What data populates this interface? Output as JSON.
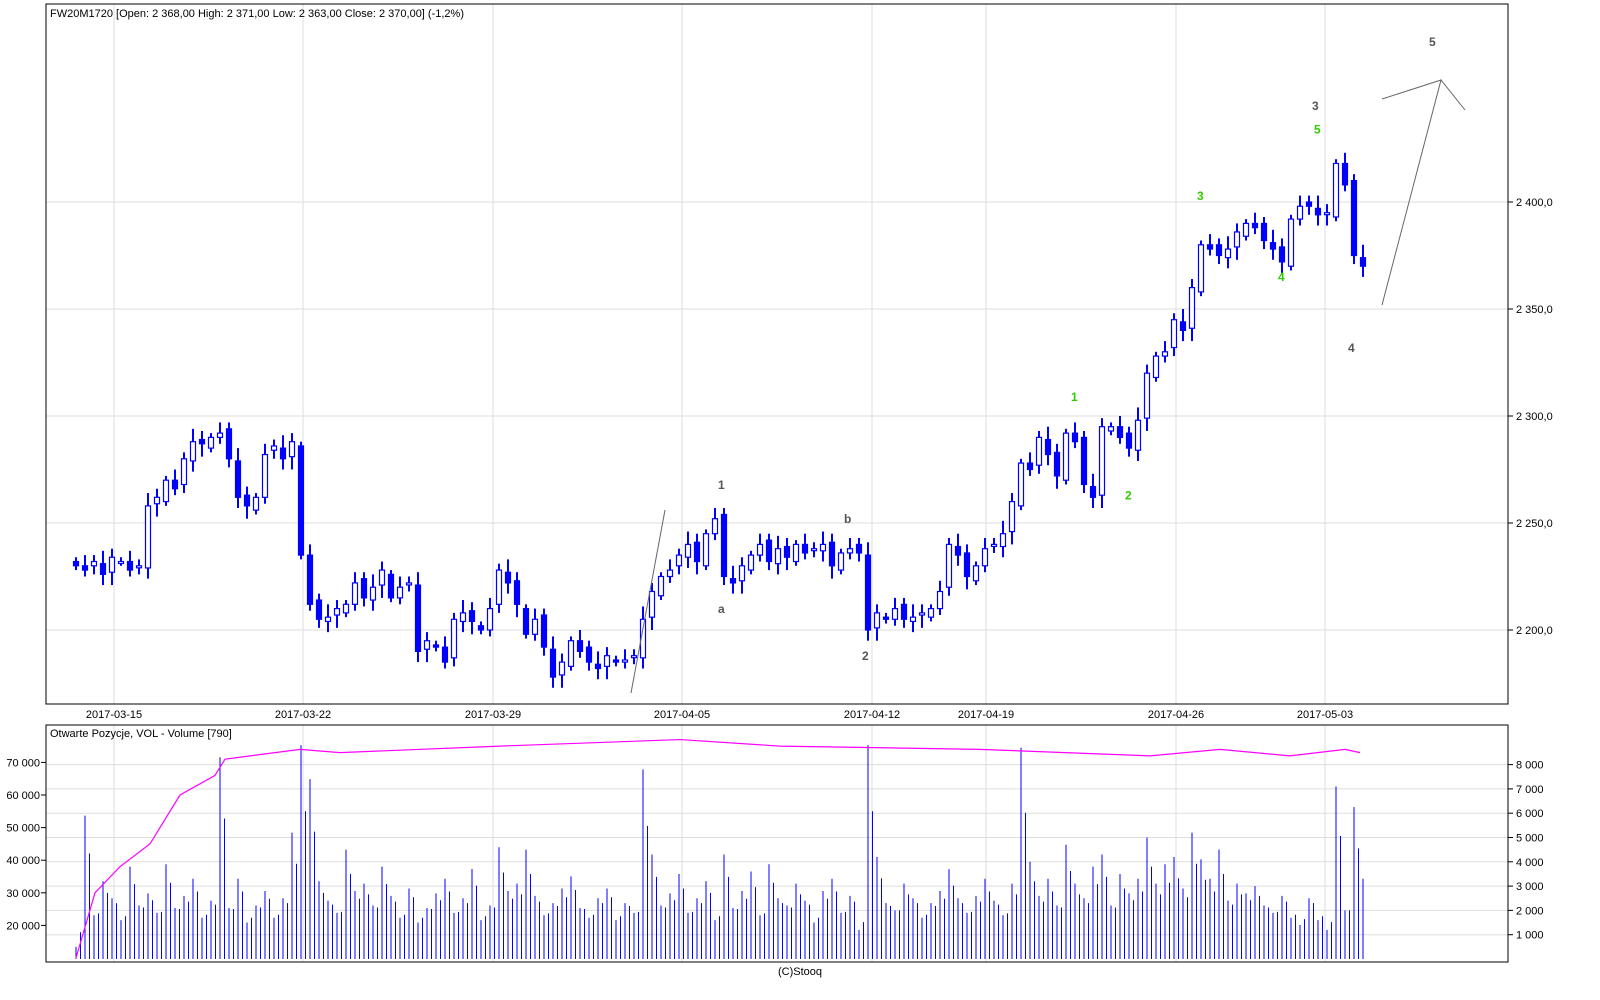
{
  "header": {
    "title": "FW20M1720 [Open: 2 368,00  High: 2 371,00  Low: 2 363,00  Close: 2 370,00] (-1,2%)"
  },
  "lower_title": "Otwarte Pozycje, VOL - Volume [790]",
  "footer": "(C)Stooq",
  "colors": {
    "candle": "#0000ff",
    "oi_line": "#ff00ff",
    "green_label": "#33cc00",
    "gray_label": "#555555",
    "grid": "#dddddd"
  },
  "chart_data": [
    {
      "type": "candlestick",
      "title": "FW20M1720",
      "price_ticks": [
        {
          "v": 2400,
          "label": "2 400,0"
        },
        {
          "v": 2350,
          "label": "2 350,0"
        },
        {
          "v": 2300,
          "label": "2 300,0"
        },
        {
          "v": 2250,
          "label": "2 250,0"
        },
        {
          "v": 2200,
          "label": "2 200,0"
        }
      ],
      "date_ticks": [
        "2017-03-15",
        "2017-03-22",
        "2017-03-29",
        "2017-04-05",
        "2017-04-12",
        "2017-04-19",
        "2017-04-26",
        "2017-05-03"
      ],
      "closes": [
        2230,
        2228,
        2232,
        2226,
        2234,
        2232,
        2228,
        2230,
        2258,
        2262,
        2270,
        2266,
        2280,
        2288,
        2287,
        2290,
        2292,
        2280,
        2262,
        2258,
        2262,
        2282,
        2286,
        2280,
        2288,
        2235,
        2212,
        2205,
        2206,
        2210,
        2212,
        2222,
        2215,
        2220,
        2228,
        2215,
        2220,
        2222,
        2190,
        2195,
        2192,
        2185,
        2205,
        2208,
        2204,
        2200,
        2210,
        2228,
        2222,
        2212,
        2198,
        2205,
        2192,
        2178,
        2185,
        2195,
        2190,
        2185,
        2182,
        2188,
        2185,
        2186,
        2188,
        2205,
        2218,
        2225,
        2228,
        2235,
        2240,
        2232,
        2245,
        2252,
        2225,
        2222,
        2230,
        2235,
        2240,
        2232,
        2238,
        2234,
        2240,
        2236,
        2238,
        2240,
        2230,
        2236,
        2238,
        2236,
        2200,
        2208,
        2205,
        2210,
        2205,
        2206,
        2208,
        2210,
        2218,
        2240,
        2235,
        2225,
        2230,
        2238,
        2240,
        2245,
        2260,
        2278,
        2275,
        2290,
        2282,
        2272,
        2292,
        2288,
        2268,
        2262,
        2295,
        2295,
        2290,
        2285,
        2298,
        2320,
        2328,
        2330,
        2345,
        2340,
        2360,
        2380,
        2378,
        2375,
        2378,
        2386,
        2390,
        2388,
        2382,
        2378,
        2372,
        2392,
        2398,
        2398,
        2394,
        2395,
        2418,
        2408,
        2375,
        2370
      ],
      "annotations_gray": [
        {
          "t": "1",
          "price": 2266,
          "i": 72
        },
        {
          "t": "a",
          "price": 2208,
          "i": 72
        },
        {
          "t": "b",
          "price": 2250,
          "i": 86
        },
        {
          "t": "2",
          "price": 2186,
          "i": 88
        },
        {
          "t": "3",
          "price": 2443,
          "i": 138
        },
        {
          "t": "4",
          "price": 2330,
          "i": 142
        },
        {
          "t": "5",
          "price": 2473,
          "i": 151
        }
      ],
      "annotations_green": [
        {
          "t": "1",
          "price": 2307,
          "i": 111
        },
        {
          "t": "2",
          "price": 2261,
          "i": 117
        },
        {
          "t": "3",
          "price": 2401,
          "i": 125
        },
        {
          "t": "4",
          "price": 2363,
          "i": 134
        },
        {
          "t": "5",
          "price": 2432,
          "i": 138
        }
      ]
    },
    {
      "type": "bar+line",
      "title": "Otwarte Pozycje, VOL - Volume [790]",
      "left_ticks": [
        "70 000",
        "60 000",
        "50 000",
        "40 000",
        "30 000",
        "20 000"
      ],
      "right_ticks": [
        "8 000",
        "7 000",
        "6 000",
        "5 000",
        "4 000",
        "3 000",
        "2 000",
        "1 000"
      ],
      "volume": [
        500,
        5900,
        1800,
        3200,
        2500,
        1600,
        3800,
        2200,
        2700,
        1900,
        3900,
        2100,
        2600,
        3300,
        1700,
        2400,
        8300,
        2100,
        3300,
        1500,
        2200,
        2800,
        1700,
        2500,
        5200,
        8800,
        7400,
        3200,
        2400,
        1900,
        4500,
        2800,
        3100,
        2200,
        3800,
        2600,
        1700,
        2900,
        1500,
        2100,
        2700,
        3300,
        1900,
        2500,
        3700,
        1600,
        2200,
        4600,
        2800,
        3100,
        4500,
        2600,
        1800,
        2300,
        2900,
        3400,
        2100,
        1700,
        2500,
        2900,
        1600,
        2300,
        1900,
        7800,
        4300,
        2200,
        2700,
        3500,
        1900,
        2500,
        3200,
        1600,
        4300,
        2100,
        2800,
        3600,
        1800,
        3900,
        2500,
        2200,
        3100,
        2400,
        1500,
        2800,
        3300,
        1900,
        2600,
        1200,
        8800,
        4200,
        2300,
        2000,
        3100,
        2500,
        1700,
        2300,
        2800,
        3700,
        2500,
        1900,
        2600,
        3300,
        2400,
        1800,
        3100,
        8700,
        4000,
        2600,
        3300,
        2200,
        4700,
        3100,
        2500,
        3800,
        4300,
        2200,
        3500,
        2700,
        3300,
        5000,
        3100,
        3900,
        4200,
        2900,
        5200,
        4100,
        3300,
        4500,
        2400,
        3100,
        2700,
        3000,
        2200,
        1900,
        2600,
        1700,
        1400,
        2500,
        1600,
        1200,
        7100,
        2000,
        6250,
        3300
      ],
      "open_interest": [
        10000,
        30000,
        38000,
        45000,
        60000,
        66000,
        71000,
        74000,
        73000,
        75000,
        77000,
        75000,
        74000,
        72000,
        74000,
        72000,
        74000,
        73000
      ]
    }
  ]
}
